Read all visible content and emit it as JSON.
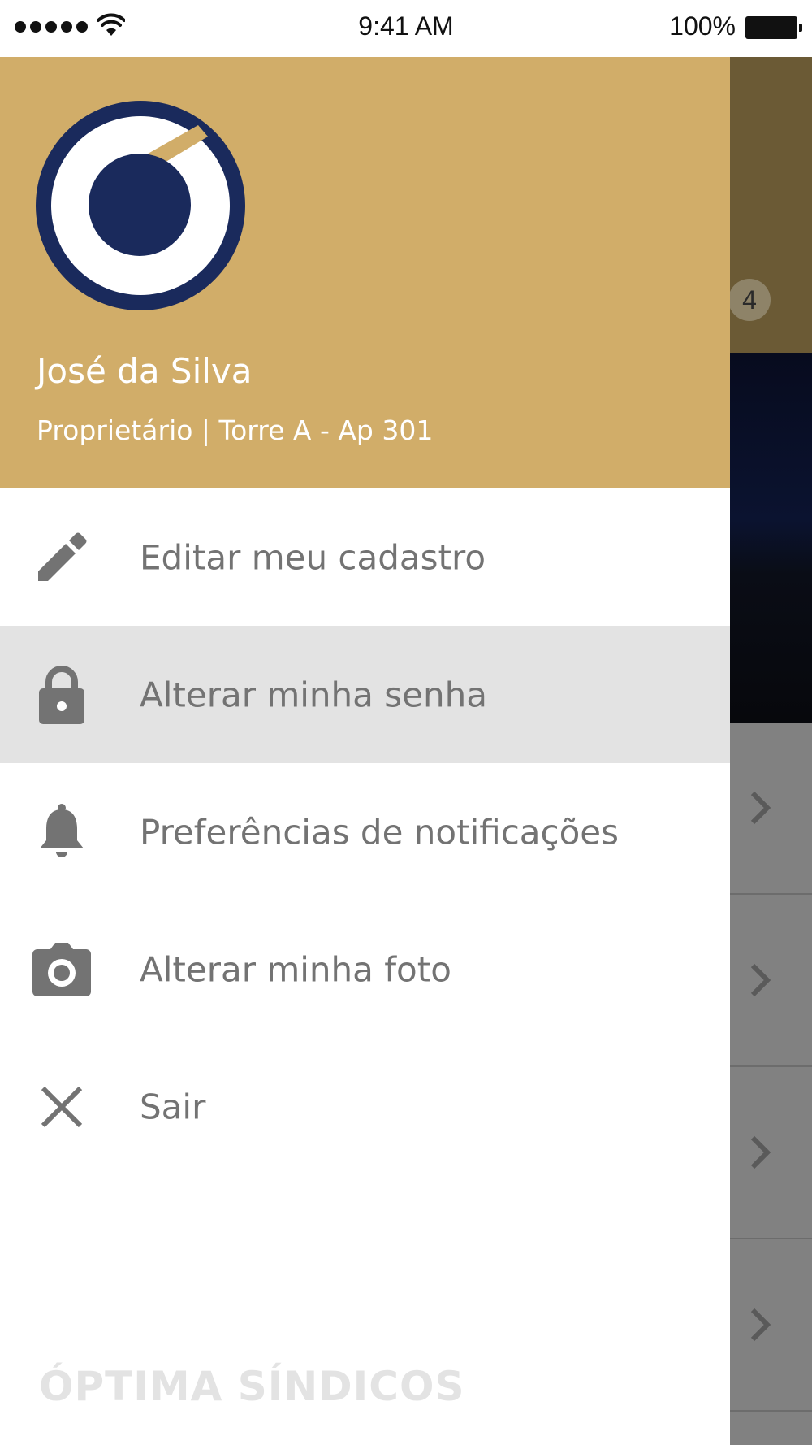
{
  "status_bar": {
    "time": "9:41 AM",
    "battery": "100%"
  },
  "profile": {
    "name": "José da Silva",
    "role": "Proprietário | Torre A - Ap 301",
    "avatar_icon": "logo-ring-icon"
  },
  "menu": {
    "items": [
      {
        "label": "Editar meu cadastro",
        "icon": "pencil-icon",
        "active": false
      },
      {
        "label": "Alterar minha senha",
        "icon": "lock-icon",
        "active": true
      },
      {
        "label": "Preferências de notificações",
        "icon": "bell-icon",
        "active": false
      },
      {
        "label": "Alterar minha foto",
        "icon": "camera-icon",
        "active": false
      },
      {
        "label": "Sair",
        "icon": "close-icon",
        "active": false
      }
    ]
  },
  "brand": {
    "text": "ÓPTIMA SÍNDICOS"
  },
  "background_app": {
    "badge_count": "4"
  },
  "colors": {
    "header_gold": "#d1ad69",
    "logo_navy": "#1a2a5c",
    "menu_text": "#737373",
    "active_row": "#e3e3e3"
  }
}
